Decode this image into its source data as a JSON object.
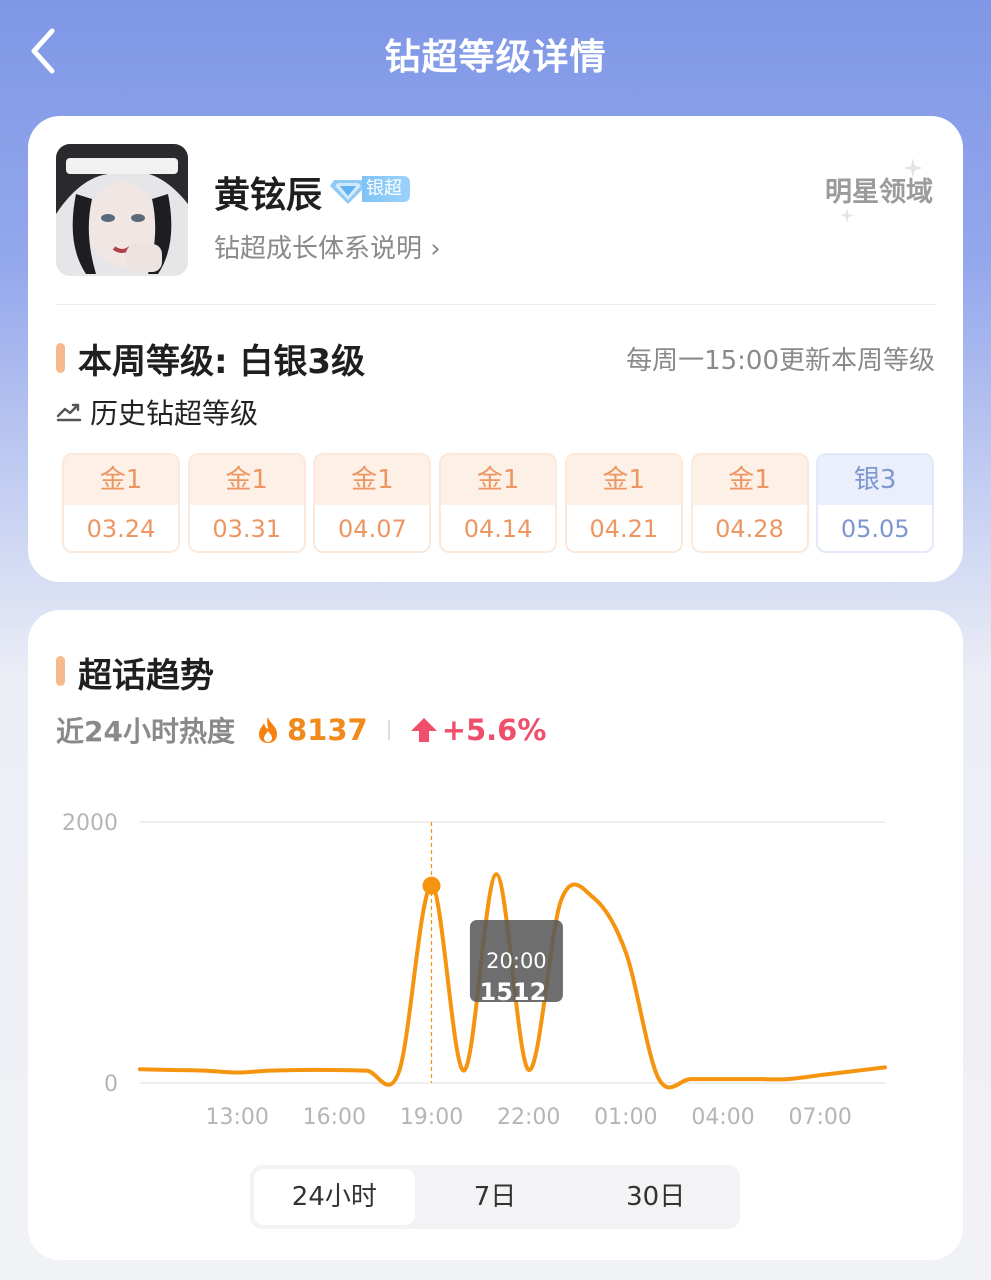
{
  "header": {
    "title": "钻超等级详情",
    "back_icon": "back-arrow-icon"
  },
  "profile": {
    "name": "黄铉辰",
    "badge_label": "银超",
    "growth_link": "钻超成长体系说明 ›",
    "star_field": "明星领域"
  },
  "level": {
    "current": "本周等级: 白银3级",
    "update_note": "每周一15:00更新本周等级",
    "history_title": "历史钻超等级",
    "history": [
      {
        "level": "金1",
        "date": "03.24",
        "tier": "gold"
      },
      {
        "level": "金1",
        "date": "03.31",
        "tier": "gold"
      },
      {
        "level": "金1",
        "date": "04.07",
        "tier": "gold"
      },
      {
        "level": "金1",
        "date": "04.14",
        "tier": "gold"
      },
      {
        "level": "金1",
        "date": "04.21",
        "tier": "gold"
      },
      {
        "level": "金1",
        "date": "04.28",
        "tier": "gold"
      },
      {
        "level": "银3",
        "date": "05.05",
        "tier": "silver"
      }
    ]
  },
  "trend": {
    "title": "超话趋势",
    "heat_label": "近24小时热度",
    "heat_value": "8137",
    "heat_change": "+5.6%",
    "tabs": [
      "24小时",
      "7日",
      "30日"
    ],
    "active_tab": 0
  },
  "chart_data": {
    "type": "line",
    "x": [
      "10:00",
      "11:00",
      "12:00",
      "13:00",
      "14:00",
      "15:00",
      "16:00",
      "17:00",
      "18:00",
      "19:00",
      "20:00",
      "21:00",
      "22:00",
      "23:00",
      "00:00",
      "01:00",
      "02:00",
      "03:00",
      "04:00",
      "05:00",
      "06:00",
      "07:00",
      "08:00",
      "09:00"
    ],
    "xticks": [
      "13:00",
      "16:00",
      "19:00",
      "22:00",
      "01:00",
      "04:00",
      "07:00"
    ],
    "ylim": [
      0,
      2000
    ],
    "yticks": [
      "0",
      "2000"
    ],
    "series": [
      {
        "values": [
          105,
          100,
          95,
          80,
          95,
          100,
          100,
          95,
          90,
          1512,
          95,
          1600,
          100,
          1400,
          1420,
          1000,
          40,
          30,
          30,
          30,
          30,
          60,
          90,
          120
        ]
      }
    ],
    "tooltip": {
      "time": "20:00",
      "value": "1512"
    },
    "highlight_index": 9,
    "line_color": "#f5940f"
  }
}
